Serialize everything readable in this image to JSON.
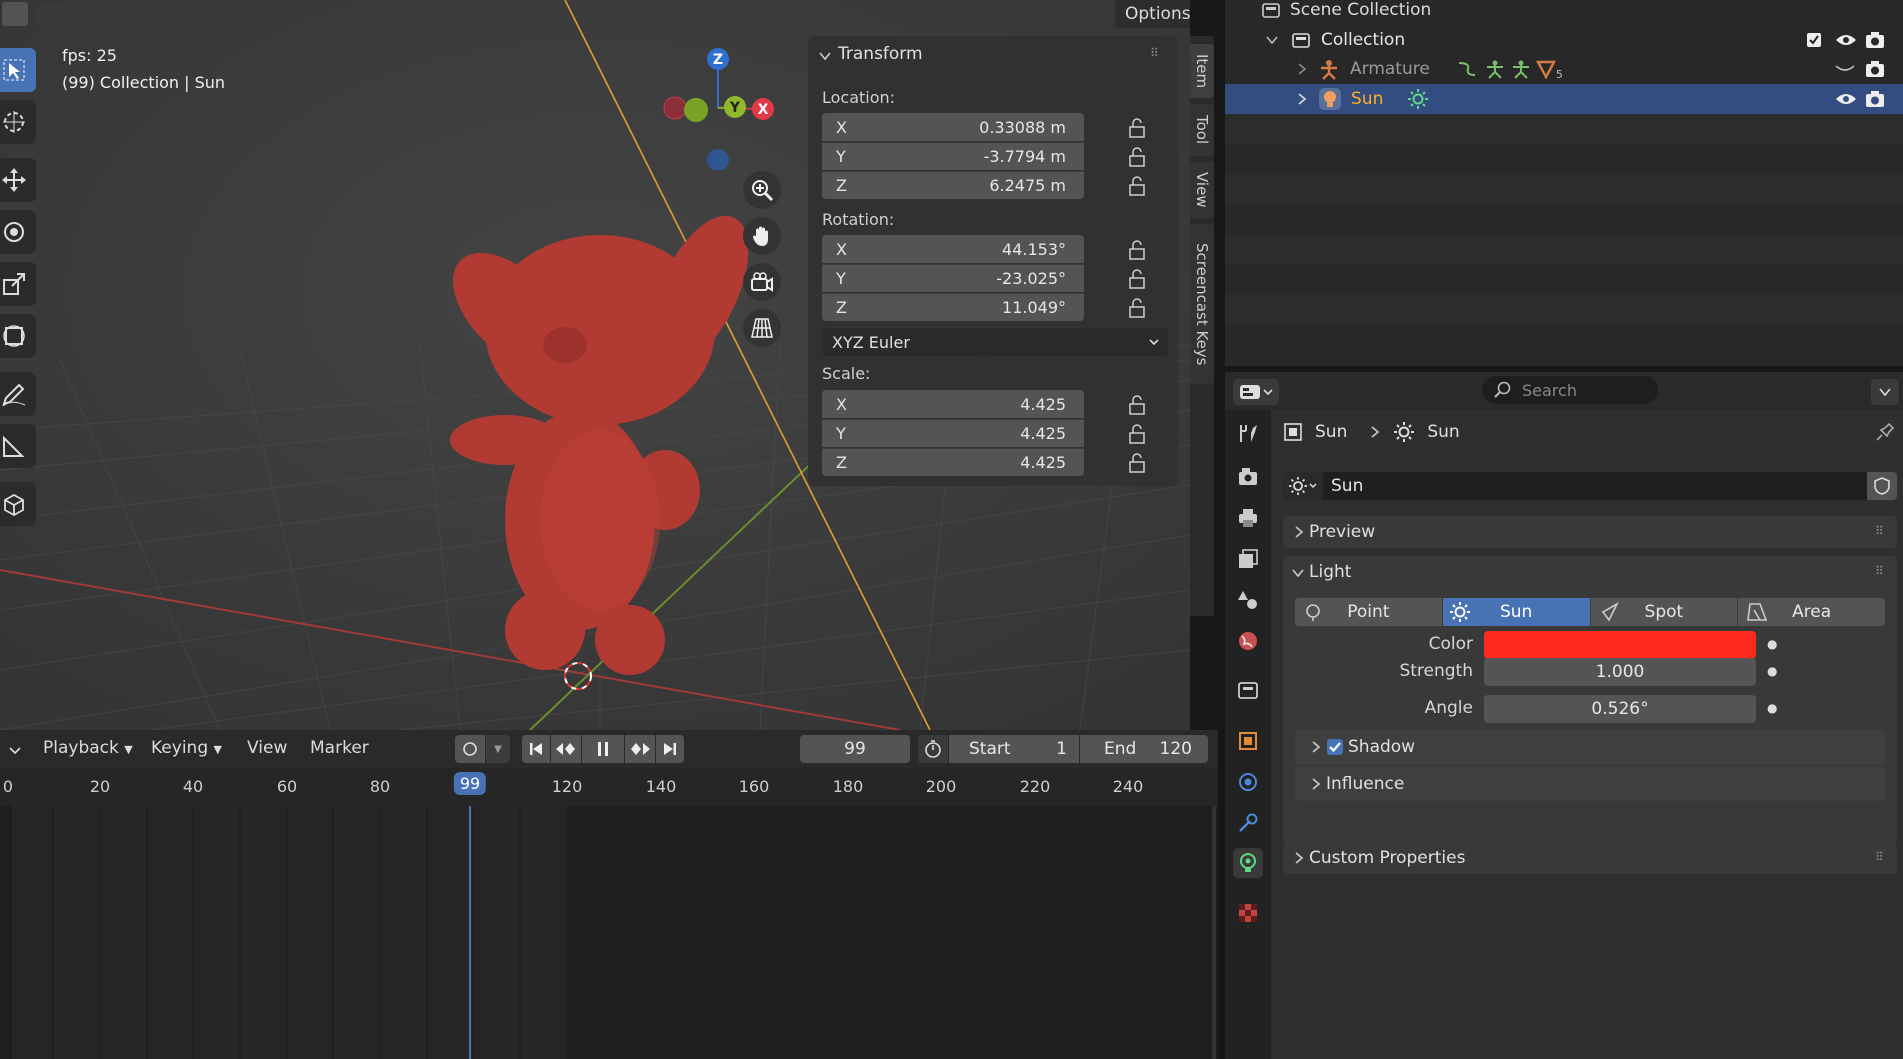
{
  "viewport": {
    "fps": "fps: 25",
    "context": "(99) Collection | Sun",
    "options_label": "Options",
    "gizmo": {
      "z": "Z",
      "y": "Y",
      "x": "X"
    },
    "tabs": [
      "Item",
      "Tool",
      "View",
      "Screencast Keys"
    ]
  },
  "transform": {
    "title": "Transform",
    "location_label": "Location:",
    "location": [
      {
        "axis": "X",
        "value": "0.33088 m"
      },
      {
        "axis": "Y",
        "value": "-3.7794 m"
      },
      {
        "axis": "Z",
        "value": "6.2475 m"
      }
    ],
    "rotation_label": "Rotation:",
    "rotation": [
      {
        "axis": "X",
        "value": "44.153°"
      },
      {
        "axis": "Y",
        "value": "-23.025°"
      },
      {
        "axis": "Z",
        "value": "11.049°"
      }
    ],
    "rotation_mode": "XYZ Euler",
    "scale_label": "Scale:",
    "scale": [
      {
        "axis": "X",
        "value": "4.425"
      },
      {
        "axis": "Y",
        "value": "4.425"
      },
      {
        "axis": "Z",
        "value": "4.425"
      }
    ]
  },
  "timeline": {
    "menus": {
      "playback": "Playback",
      "keying": "Keying",
      "view": "View",
      "marker": "Marker"
    },
    "current_frame": "99",
    "start_label": "Start",
    "start_value": "1",
    "end_label": "End",
    "end_value": "120",
    "ruler": [
      "0",
      "20",
      "40",
      "60",
      "80",
      "99",
      "120",
      "140",
      "160",
      "180",
      "200",
      "220",
      "240"
    ]
  },
  "outliner": {
    "scene_collection": "Scene Collection",
    "collection": "Collection",
    "armature": "Armature",
    "armature_count": "5",
    "sun": "Sun"
  },
  "properties": {
    "search_placeholder": "Search",
    "breadcrumb_object": "Sun",
    "breadcrumb_data": "Sun",
    "datablock_name": "Sun",
    "preview": "Preview",
    "light": "Light",
    "light_types": {
      "point": "Point",
      "sun": "Sun",
      "spot": "Spot",
      "area": "Area"
    },
    "color_label": "Color",
    "color_value": "#ff2b1f",
    "strength_label": "Strength",
    "strength_value": "1.000",
    "angle_label": "Angle",
    "angle_value": "0.526°",
    "shadow": "Shadow",
    "influence": "Influence",
    "custom_properties": "Custom Properties"
  },
  "colors": {
    "accent": "#4772b3",
    "selected_row": "#334d80",
    "active_text": "#ffaf29",
    "light_icon": "#5fd98a"
  }
}
